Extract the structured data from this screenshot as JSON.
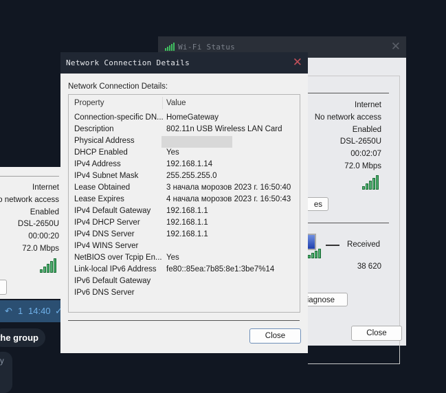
{
  "left_window": {
    "values": [
      "Internet",
      "No network access",
      "Enabled",
      "DSL-2650U",
      "00:00:20",
      "72.0 Mbps"
    ]
  },
  "chat": {
    "reply_count": "1",
    "time": "14:40",
    "pill": "the group",
    "bubble_text": "y"
  },
  "wifi_status": {
    "title": "Wi-Fi Status",
    "values": [
      "Internet",
      "No network access",
      "Enabled",
      "DSL-2650U",
      "00:02:07",
      "72.0 Mbps"
    ],
    "details_button": "es",
    "received_label": "Received",
    "received_value": "38 620",
    "diagnose_button": "Diagnose",
    "close_button": "Close"
  },
  "details": {
    "title": "Network Connection Details",
    "label": "Network Connection Details:",
    "columns": [
      "Property",
      "Value"
    ],
    "rows": [
      {
        "p": "Connection-specific DN...",
        "v": "HomeGateway"
      },
      {
        "p": "Description",
        "v": "802.11n USB Wireless LAN Card"
      },
      {
        "p": "Physical Address",
        "v": ""
      },
      {
        "p": "DHCP Enabled",
        "v": "Yes"
      },
      {
        "p": "IPv4 Address",
        "v": "192.168.1.14"
      },
      {
        "p": "IPv4 Subnet Mask",
        "v": "255.255.255.0"
      },
      {
        "p": "Lease Obtained",
        "v": "3 начала морозов 2023 г. 16:50:40"
      },
      {
        "p": "Lease Expires",
        "v": "4 начала морозов 2023 г. 16:50:43"
      },
      {
        "p": "IPv4 Default Gateway",
        "v": "192.168.1.1"
      },
      {
        "p": "IPv4 DHCP Server",
        "v": "192.168.1.1"
      },
      {
        "p": "IPv4 DNS Server",
        "v": "192.168.1.1"
      },
      {
        "p": "IPv4 WINS Server",
        "v": ""
      },
      {
        "p": "NetBIOS over Tcpip En...",
        "v": "Yes"
      },
      {
        "p": "Link-local IPv6 Address",
        "v": "fe80::85ea:7b85:8e1:3be7%14"
      },
      {
        "p": "IPv6 Default Gateway",
        "v": ""
      },
      {
        "p": "IPv6 DNS Server",
        "v": ""
      }
    ],
    "close_button": "Close"
  },
  "colors": {
    "titlebar": "#202733",
    "close_x": "#c0505a",
    "panel": "#f0f0f0",
    "chat_bar": "#2b4f72"
  }
}
